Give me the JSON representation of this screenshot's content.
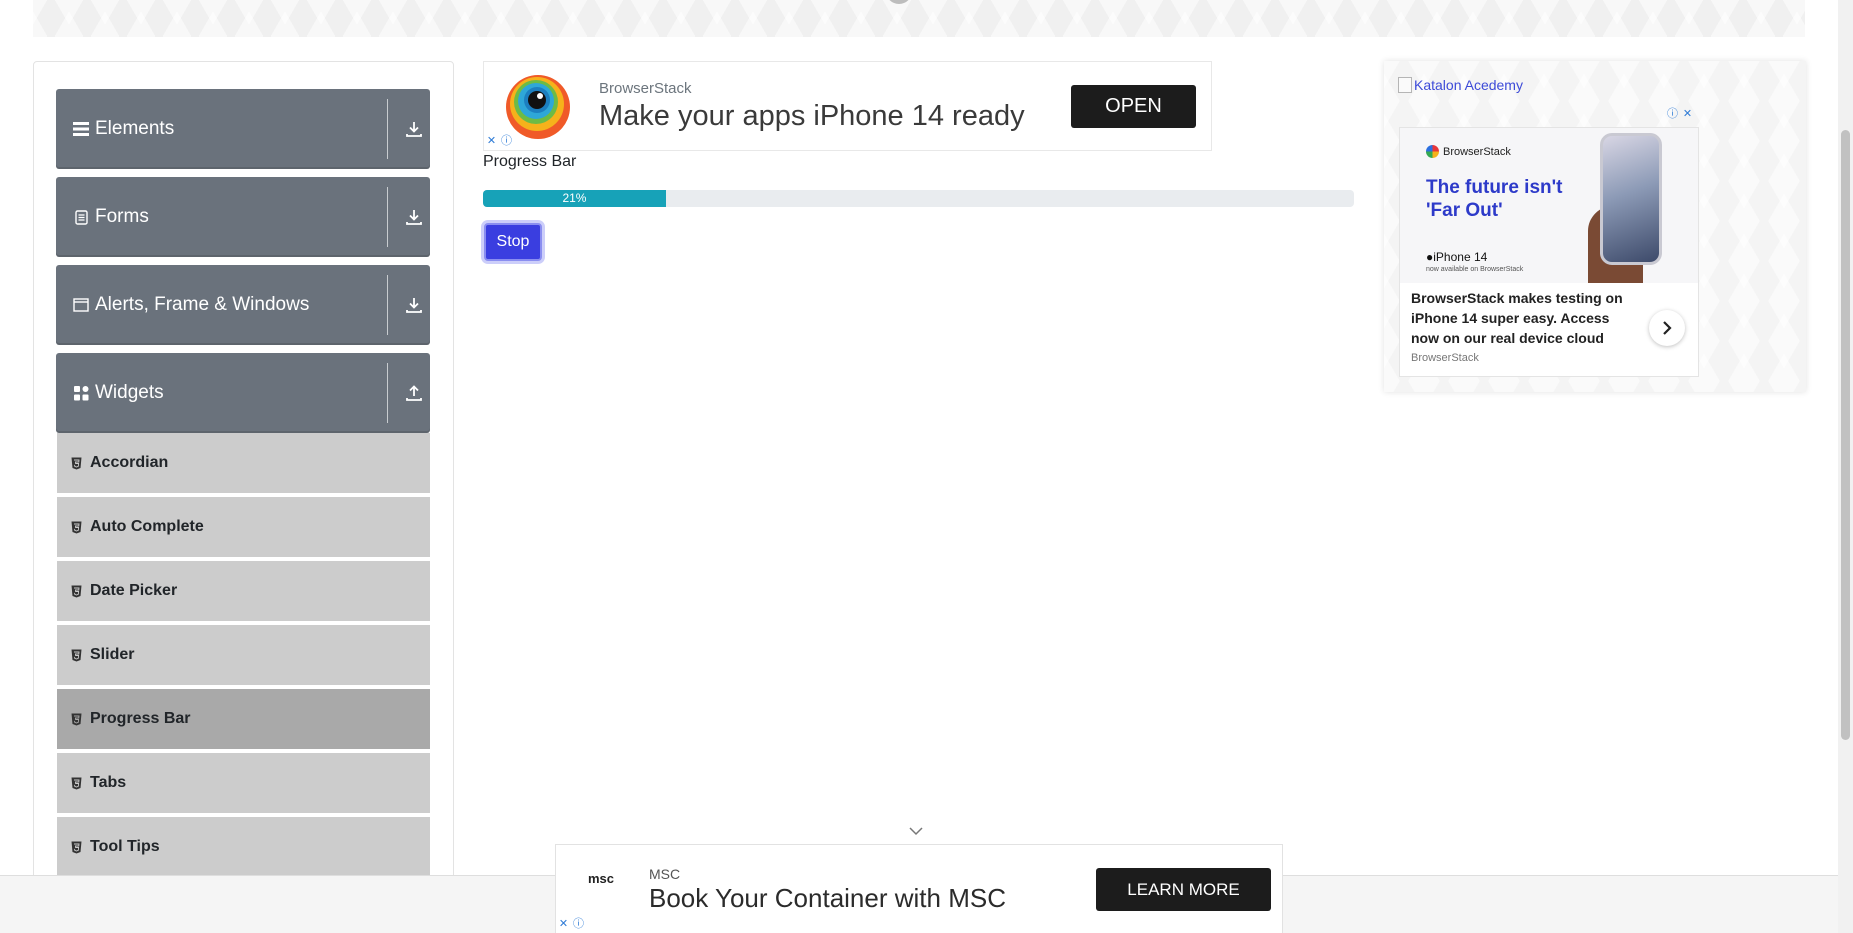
{
  "sidebar": {
    "groups": [
      {
        "label": "Elements",
        "icon": "list-icon",
        "state": "collapsed"
      },
      {
        "label": "Forms",
        "icon": "document-icon",
        "state": "collapsed"
      },
      {
        "label": "Alerts, Frame & Windows",
        "icon": "window-icon",
        "state": "collapsed"
      },
      {
        "label": "Widgets",
        "icon": "widgets-icon",
        "state": "expanded"
      }
    ],
    "widgets_items": [
      {
        "label": "Accordian"
      },
      {
        "label": "Auto Complete"
      },
      {
        "label": "Date Picker"
      },
      {
        "label": "Slider"
      },
      {
        "label": "Progress Bar",
        "active": true
      },
      {
        "label": "Tabs"
      },
      {
        "label": "Tool Tips"
      }
    ]
  },
  "ad_top": {
    "brand": "BrowserStack",
    "headline": "Make your apps iPhone 14 ready",
    "cta": "OPEN"
  },
  "main": {
    "title": "Progress Bar",
    "progress": {
      "value": 21,
      "label": "21%"
    },
    "stop_label": "Stop",
    "accent_color": "#17a2b8",
    "button_color": "#3a3ee0"
  },
  "right": {
    "link_text": "Katalon Acedemy",
    "ad": {
      "brand": "BrowserStack",
      "tagline": "The future isn't 'Far Out'",
      "product": "iPhone 14",
      "product_sub": "now available on BrowserStack",
      "body": "BrowserStack makes testing on iPhone 14 super easy. Access now on our real device cloud",
      "footer": "BrowserStack"
    }
  },
  "ad_bottom": {
    "logo_text": "msc",
    "brand": "MSC",
    "headline": "Book Your Container with MSC",
    "cta": "LEARN MORE"
  }
}
